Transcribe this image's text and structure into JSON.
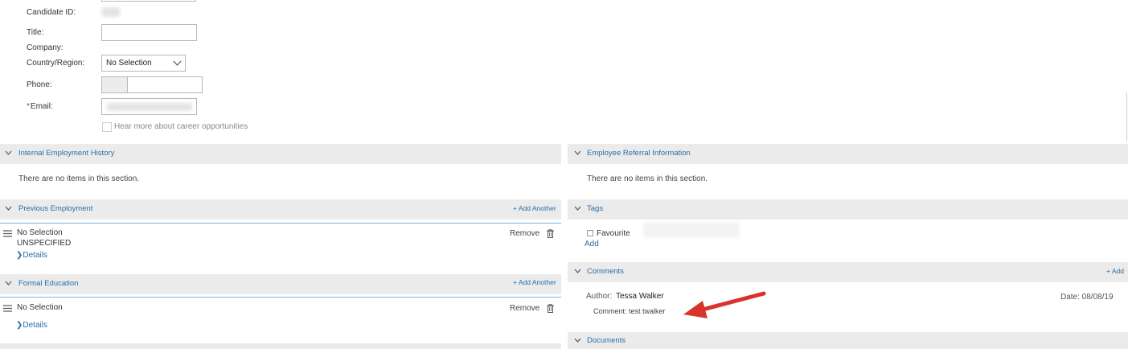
{
  "form": {
    "candidate_id_label": "Candidate ID:",
    "title_label": "Title:",
    "company_label": "Company:",
    "country_label": "Country/Region:",
    "country_value": "No Selection",
    "phone_label": "Phone:",
    "email_required_mark": "*",
    "email_label": "Email:",
    "career_opportunities_label": "Hear more about career opportunities"
  },
  "left_sections": {
    "internal_employment": {
      "title": "Internal Employment History",
      "empty_text": "There are no items in this section."
    },
    "previous_employment": {
      "title": "Previous Employment",
      "add_label": "+ Add Another",
      "item_primary": "No Selection",
      "item_secondary": "UNSPECIFIED",
      "details_label": "Details",
      "remove_label": "Remove"
    },
    "formal_education": {
      "title": "Formal Education",
      "add_label": "+ Add Another",
      "item_primary": "No Selection",
      "details_label": "Details",
      "remove_label": "Remove"
    }
  },
  "right_sections": {
    "employee_referral": {
      "title": "Employee Referral Information",
      "empty_text": "There are no items in this section."
    },
    "tags": {
      "title": "Tags",
      "favourite_label": "Favourite",
      "add_label": "Add"
    },
    "comments": {
      "title": "Comments",
      "add_label": "+ Add",
      "author_label": "Author:",
      "author_name": "Tessa Walker",
      "date_label": "Date: 08/08/19",
      "comment_text": "Comment: test twalker"
    },
    "documents": {
      "title": "Documents"
    }
  },
  "annotation": {
    "arrow_color": "#d9342b"
  }
}
